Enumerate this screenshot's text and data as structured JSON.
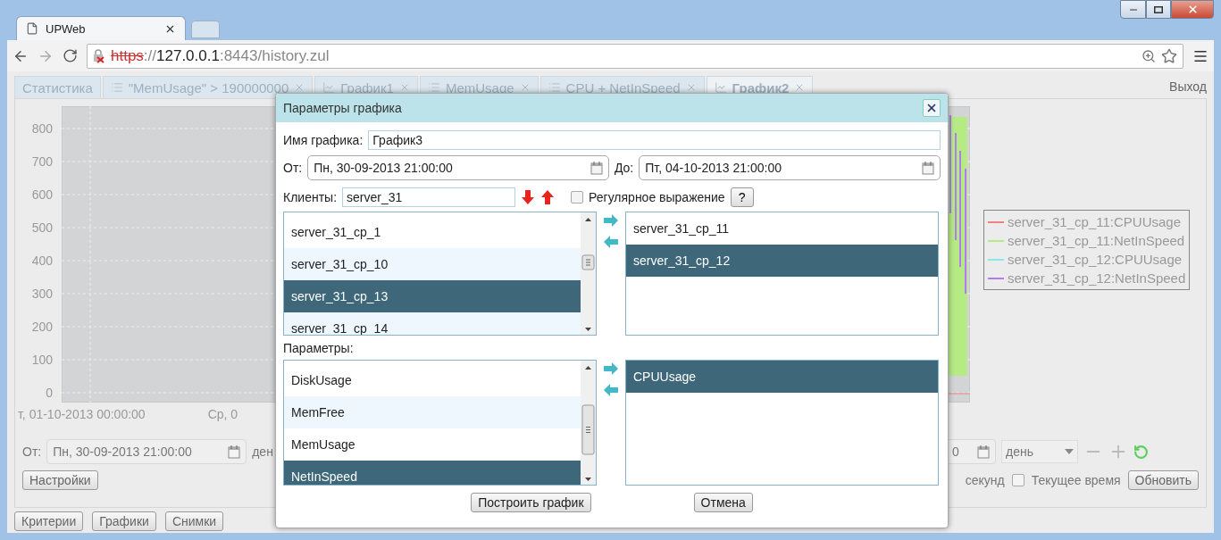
{
  "browser": {
    "tab_title": "UPWeb",
    "address": {
      "scheme": "https",
      "separator": "://",
      "host": "127.0.0.1",
      "rest": ":8443/history.zul"
    }
  },
  "app_tabs": [
    {
      "label": "Статистика",
      "kind": "plain",
      "selected": false
    },
    {
      "label": "\"MemUsage\" > 190000000",
      "kind": "list",
      "selected": false
    },
    {
      "label": "График1",
      "kind": "chart",
      "selected": false
    },
    {
      "label": "MemUsage",
      "kind": "list",
      "selected": false
    },
    {
      "label": "CPU + NetInSpeed",
      "kind": "list",
      "selected": false
    },
    {
      "label": "График2",
      "kind": "chart",
      "selected": true
    }
  ],
  "logout": "Выход",
  "chart": {
    "y_labels": [
      "800",
      "700",
      "600",
      "500",
      "400",
      "300",
      "200",
      "100",
      "0"
    ],
    "x_labels": [
      "т, 01-10-2013 00:00:00",
      "Ср, 0"
    ],
    "legend": [
      {
        "label": "server_31_cp_11:CPUUsage",
        "color": "#f28080"
      },
      {
        "label": "server_31_cp_11:NetInSpeed",
        "color": "#b5ea85"
      },
      {
        "label": "server_31_cp_12:CPUUsage",
        "color": "#8ee6ea"
      },
      {
        "label": "server_31_cp_12:NetInSpeed",
        "color": "#b07cf0"
      }
    ]
  },
  "controls": {
    "from_label": "От:",
    "from_value": "Пн, 30-09-2013 21:00:00",
    "period_partial": "ден",
    "to_partial": "0",
    "period": "день",
    "settings": "Настройки",
    "seconds": "секунд",
    "current_time": {
      "label": "Текущее время",
      "checked": false
    },
    "refresh": "Обновить"
  },
  "footer_buttons": [
    "Критерии",
    "Графики",
    "Снимки"
  ],
  "dialog": {
    "title": "Параметры графика",
    "name_label": "Имя графика:",
    "name_value": "График3",
    "from_label": "От:",
    "from_value": "Пн, 30-09-2013 21:00:00",
    "to_label": "До:",
    "to_value": "Пт, 04-10-2013 21:00:00",
    "clients_label": "Клиенты:",
    "clients_value": "server_31",
    "regex": {
      "label": "Регулярное выражение",
      "checked": false
    },
    "help": "?",
    "clients_available": [
      {
        "label": "server_31_cp_1",
        "selected": false
      },
      {
        "label": "server_31_cp_10",
        "selected": false
      },
      {
        "label": "server_31_cp_13",
        "selected": true
      },
      {
        "label": "server_31_cp_14",
        "selected": false
      }
    ],
    "clients_chosen": [
      {
        "label": "server_31_cp_11",
        "selected": false
      },
      {
        "label": "server_31_cp_12",
        "selected": true
      }
    ],
    "params_label": "Параметры:",
    "params_available": [
      {
        "label": "DiskUsage",
        "selected": false
      },
      {
        "label": "MemFree",
        "selected": false
      },
      {
        "label": "MemUsage",
        "selected": false
      },
      {
        "label": "NetInSpeed",
        "selected": true
      }
    ],
    "params_chosen": [
      {
        "label": "CPUUsage",
        "selected": true
      }
    ],
    "buttons": [
      "Построить график",
      "Отмена"
    ]
  }
}
